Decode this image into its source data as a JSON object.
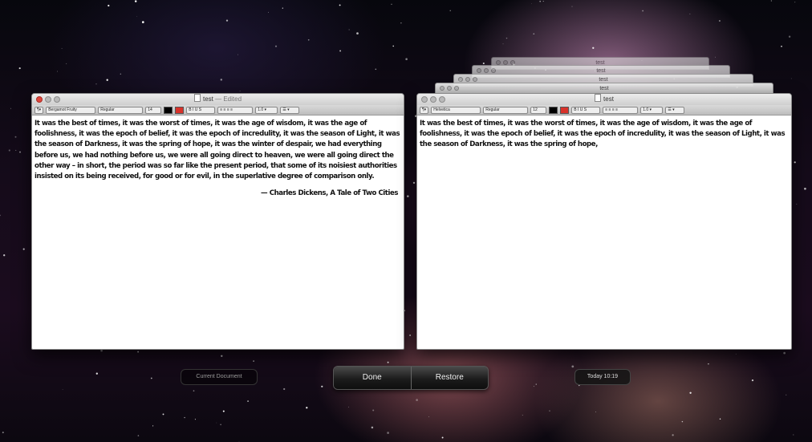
{
  "left_window": {
    "title": "test",
    "title_suffix": "— Edited",
    "toolbar": {
      "format_btn": "¶▾",
      "font_family": "Bergamot Fruity",
      "font_style": "Regular",
      "font_size": "14",
      "align_text": "≡ ≡ ≡ ≡",
      "spacing": "1.0 ▾",
      "list": "☰ ▾"
    },
    "paragraph": "It was the best of times, it was the worst of times, it was the age of wisdom, it was the age of foolishness, it was the epoch of belief, it was the epoch of incredulity, it was the season of Light, it was the season of Darkness, it was the spring of hope, it was the winter of despair, we had everything before us, we had nothing before us, we were all going direct to heaven, we were all going direct the other way – in short, the period was so far like the present period, that some of its noisiest authorities insisted on its being received, for good or for evil, in the superlative degree of comparison only.",
    "attribution": "— Charles Dickens, A Tale of Two Cities"
  },
  "right_window": {
    "title": "test",
    "toolbar": {
      "format_btn": "¶▾",
      "font_family": "Helvetica",
      "font_style": "Regular",
      "font_size": "12",
      "align_text": "≡ ≡ ≡ ≡",
      "spacing": "1.0 ▾",
      "list": "☰ ▾"
    },
    "paragraph": "It was the best of times, it was the worst of times, it was the age of wisdom, it was the age of foolishness, it was the epoch of belief, it was the epoch of incredulity, it was the season of Light, it was the season of Darkness, it was the spring of hope,"
  },
  "stacked_versions": [
    {
      "title": "test"
    },
    {
      "title": "test"
    },
    {
      "title": "test"
    },
    {
      "title": "test"
    }
  ],
  "hud": {
    "current_document": "Current Document",
    "done": "Done",
    "restore": "Restore",
    "timestamp": "Today 10:19"
  }
}
